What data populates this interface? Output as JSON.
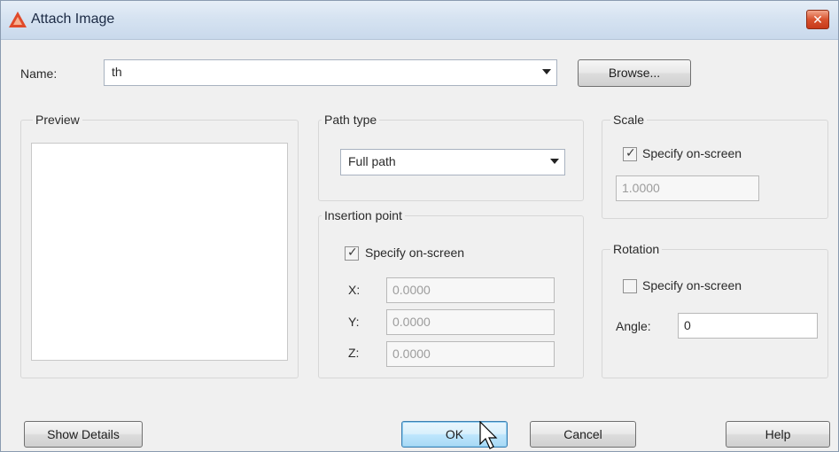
{
  "window": {
    "title": "Attach Image",
    "close_glyph": "✕"
  },
  "name_row": {
    "label": "Name:",
    "value": "th",
    "browse_label": "Browse..."
  },
  "preview": {
    "title": "Preview"
  },
  "path_type": {
    "title": "Path type",
    "selected": "Full path"
  },
  "insertion_point": {
    "title": "Insertion point",
    "specify_label": "Specify on-screen",
    "specify_checked": true,
    "x_label": "X:",
    "x_value": "0.0000",
    "y_label": "Y:",
    "y_value": "0.0000",
    "z_label": "Z:",
    "z_value": "0.0000"
  },
  "scale": {
    "title": "Scale",
    "specify_label": "Specify on-screen",
    "specify_checked": true,
    "value": "1.0000"
  },
  "rotation": {
    "title": "Rotation",
    "specify_label": "Specify on-screen",
    "specify_checked": false,
    "angle_label": "Angle:",
    "angle_value": "0"
  },
  "buttons": {
    "show_details": "Show Details",
    "ok": "OK",
    "cancel": "Cancel",
    "help": "Help"
  },
  "colors": {
    "title_bar": "#d6e3f1",
    "default_button": "#bee6fd",
    "close_button": "#d8522e"
  }
}
